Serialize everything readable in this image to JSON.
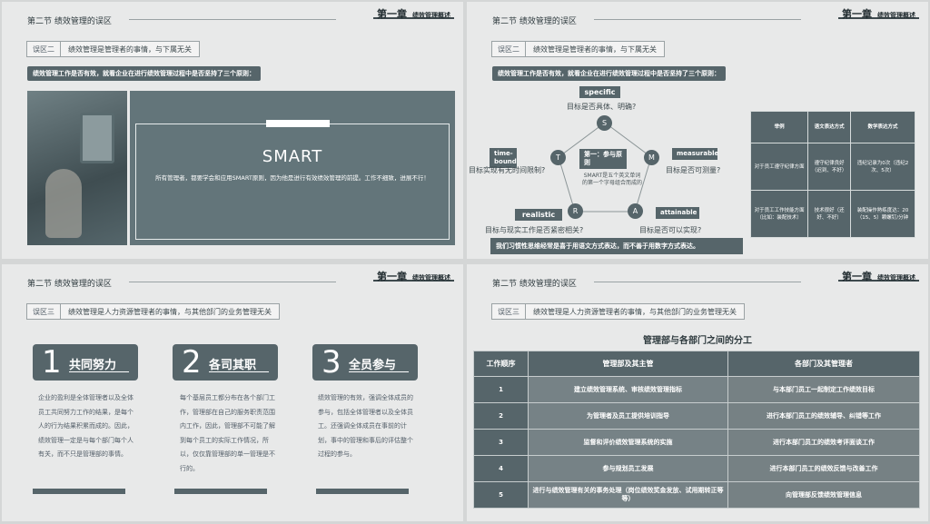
{
  "slides": [
    {
      "section": "第二节  绩效管理的误区",
      "chapter": "第一章",
      "chapter_sub": "绩效管理概述",
      "tag_key": "误区二",
      "tag_value": "绩效管理是管理者的事情，与下属无关",
      "banner": "绩效管理工作是否有效，就看企业在进行绩效管理过程中是否坚持了三个原则：",
      "smart_title": "SMART",
      "smart_desc": "所有管理者，都要学会和应用SMART原则，因为他是进行有效绩效管理的前提。工作不细致，进展不行！"
    },
    {
      "section": "第二节  绩效管理的误区",
      "chapter": "第一章",
      "chapter_sub": "绩效管理概述",
      "tag_key": "误区二",
      "tag_value": "绩效管理是管理者的事情，与下属无关",
      "banner": "绩效管理工作是否有效，就看企业在进行绩效管理过程中是否坚持了三个原则：",
      "labels": {
        "specific": "specific",
        "time_bound": "time-bound",
        "measurable": "measurable",
        "realistic": "realistic",
        "attainable": "attainable",
        "center": "第一：参与原则"
      },
      "questions": {
        "s": "目标是否具体、明确?",
        "t": "目标实现有无时间限制?",
        "m": "目标是否可测量?",
        "r": "目标与现实工作是否紧密相关?",
        "a": "目标是否可以实现?"
      },
      "nodes": [
        "S",
        "T",
        "M",
        "R",
        "A"
      ],
      "pentagon_text": "SMART是五个英文单词的第一个字母组合而成的",
      "table": {
        "headers": [
          "举例",
          "语文表达方式",
          "数学表达方式"
        ],
        "rows": [
          [
            "对于员工遵守纪律方面",
            "遵守纪律良好（迟到、不好）",
            "违纪记录为0次（违纪2次、5次）"
          ],
          [
            "对于员工工作技能方面（比如：装配技术）",
            "技术很好（还好、不好）",
            "装配操作熟练度达：20（15、5）颗螺钉/分钟"
          ]
        ]
      },
      "bottom_banner": "我们习惯性思维经常是喜于用语文方式表达，而不善于用数字方式表达。"
    },
    {
      "section": "第二节  绩效管理的误区",
      "chapter": "第一章",
      "chapter_sub": "绩效管理概述",
      "tag_key": "误区三",
      "tag_value": "绩效管理是人力资源管理者的事情，与其他部门的业务管理无关",
      "cards": [
        {
          "num": "1",
          "title": "共同努力",
          "text": "企业的盈利是全体管理者以及全体员工共同努力工作的结果，是每个人的行为结果积累而成的。因此，绩效管理一定是与每个部门每个人有关，而不只是管理部的事情。"
        },
        {
          "num": "2",
          "title": "各司其职",
          "text": "每个基层员工都分布在各个部门工作，管理部在自己的服务职责范围内工作，因此，管理部不可能了解到每个员工的实际工作情况，所以，仅仅靠管理部的单一管理是不行的。"
        },
        {
          "num": "3",
          "title": "全员参与",
          "text": "绩效管理的有效，强调全体成员的参与，包括全体管理者以及全体员工。还强调全体成员在事前的计划，事中的管理和事后的评估整个过程的参与。"
        }
      ]
    },
    {
      "section": "第二节  绩效管理的误区",
      "chapter": "第一章",
      "chapter_sub": "绩效管理概述",
      "tag_key": "误区三",
      "tag_value": "绩效管理是人力资源管理者的事情，与其他部门的业务管理无关",
      "table_title": "管理部与各部门之间的分工",
      "table": {
        "headers": [
          "工作顺序",
          "管理部及其主管",
          "各部门及其管理者"
        ],
        "rows": [
          [
            "1",
            "建立绩效管理系统、审核绩效管理指标",
            "与本部门员工一起制定工作绩效目标"
          ],
          [
            "2",
            "为管理者及员工提供培训指导",
            "进行本部门员工的绩效辅导、纠错等工作"
          ],
          [
            "3",
            "监督和评价绩效管理系统的实施",
            "进行本部门员工的绩效考评面谈工作"
          ],
          [
            "4",
            "参与规划员工发展",
            "进行本部门员工的绩效反馈与改善工作"
          ],
          [
            "5",
            "进行与绩效管理有关的事务处理（岗位绩效奖金发放、试用期转正等等）",
            "向管理部反馈绩效管理信息"
          ]
        ]
      }
    }
  ]
}
